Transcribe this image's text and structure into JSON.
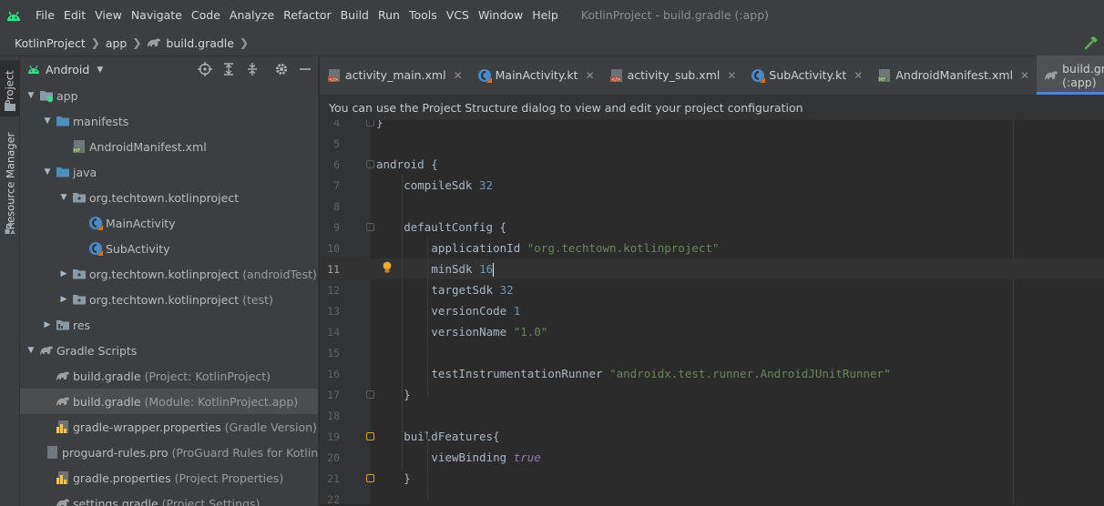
{
  "menubar": {
    "items": [
      "File",
      "Edit",
      "View",
      "Navigate",
      "Code",
      "Analyze",
      "Refactor",
      "Build",
      "Run",
      "Tools",
      "VCS",
      "Window",
      "Help"
    ],
    "window_title": "KotlinProject - build.gradle (:app)"
  },
  "breadcrumb": [
    "KotlinProject",
    "app",
    "build.gradle"
  ],
  "stripe": {
    "project_tab": "Project",
    "resource_tab": "Resource Manager"
  },
  "project_panel": {
    "view_label": "Android",
    "tree": [
      {
        "label": "app",
        "depth": 0,
        "expanded": true,
        "icon": "module-folder-icon",
        "has_arrow": true
      },
      {
        "label": "manifests",
        "depth": 1,
        "expanded": true,
        "icon": "folder-icon",
        "has_arrow": true
      },
      {
        "label": "AndroidManifest.xml",
        "depth": 2,
        "icon": "manifest-file-icon",
        "has_arrow": false
      },
      {
        "label": "java",
        "depth": 1,
        "expanded": true,
        "icon": "folder-icon",
        "has_arrow": true
      },
      {
        "label": "org.techtown.kotlinproject",
        "depth": 2,
        "expanded": true,
        "icon": "package-icon",
        "has_arrow": true
      },
      {
        "label": "MainActivity",
        "depth": 3,
        "icon": "kotlin-class-icon",
        "has_arrow": false
      },
      {
        "label": "SubActivity",
        "depth": 3,
        "icon": "kotlin-class-icon",
        "has_arrow": false
      },
      {
        "label": "org.techtown.kotlinproject",
        "suffix": "(androidTest)",
        "depth": 2,
        "expanded": false,
        "icon": "package-icon",
        "has_arrow": true
      },
      {
        "label": "org.techtown.kotlinproject",
        "suffix": "(test)",
        "depth": 2,
        "expanded": false,
        "icon": "package-icon",
        "has_arrow": true
      },
      {
        "label": "res",
        "depth": 1,
        "expanded": false,
        "icon": "res-folder-icon",
        "has_arrow": true
      },
      {
        "label": "Gradle Scripts",
        "depth": 0,
        "expanded": true,
        "icon": "gradle-icon",
        "has_arrow": true
      },
      {
        "label": "build.gradle",
        "suffix": "(Project: KotlinProject)",
        "depth": 1,
        "icon": "gradle-icon",
        "has_arrow": false
      },
      {
        "label": "build.gradle",
        "suffix": "(Module: KotlinProject.app)",
        "depth": 1,
        "icon": "gradle-icon",
        "has_arrow": false,
        "selected": true
      },
      {
        "label": "gradle-wrapper.properties",
        "suffix": "(Gradle Version)",
        "depth": 1,
        "icon": "properties-icon",
        "has_arrow": false
      },
      {
        "label": "proguard-rules.pro",
        "suffix": "(ProGuard Rules for KotlinProje",
        "depth": 1,
        "icon": "proguard-file-icon",
        "has_arrow": false
      },
      {
        "label": "gradle.properties",
        "suffix": "(Project Properties)",
        "depth": 1,
        "icon": "properties-icon",
        "has_arrow": false
      },
      {
        "label": "settings.gradle",
        "suffix": "(Project Settings)",
        "depth": 1,
        "icon": "gradle-icon",
        "has_arrow": false
      }
    ]
  },
  "tabs": [
    {
      "label": "activity_main.xml",
      "icon": "layout-xml-icon",
      "active": false
    },
    {
      "label": "MainActivity.kt",
      "icon": "kotlin-class-icon",
      "active": false
    },
    {
      "label": "activity_sub.xml",
      "icon": "layout-xml-icon",
      "active": false
    },
    {
      "label": "SubActivity.kt",
      "icon": "kotlin-class-icon",
      "active": false
    },
    {
      "label": "AndroidManifest.xml",
      "icon": "manifest-file-icon",
      "active": false
    },
    {
      "label": "build.gradle (:app)",
      "icon": "gradle-icon",
      "active": true
    }
  ],
  "banner": "You can use the Project Structure dialog to view and edit your project configuration",
  "code": {
    "current_line": 11,
    "lines": [
      {
        "num": "4",
        "indent": 0,
        "tokens": [
          [
            "p",
            "}"
          ]
        ],
        "fold": "end"
      },
      {
        "num": "5",
        "indent": 0,
        "tokens": []
      },
      {
        "num": "6",
        "indent": 0,
        "tokens": [
          [
            "p",
            "android {"
          ]
        ],
        "fold": "start"
      },
      {
        "num": "7",
        "indent": 1,
        "tokens": [
          [
            "p",
            "compileSdk "
          ],
          [
            "n",
            "32"
          ]
        ]
      },
      {
        "num": "8",
        "indent": 0,
        "tokens": []
      },
      {
        "num": "9",
        "indent": 1,
        "tokens": [
          [
            "p",
            "defaultConfig {"
          ]
        ],
        "fold": "start"
      },
      {
        "num": "10",
        "indent": 2,
        "tokens": [
          [
            "p",
            "applicationId "
          ],
          [
            "s",
            "\"org.techtown.kotlinproject\""
          ]
        ]
      },
      {
        "num": "11",
        "indent": 2,
        "tokens": [
          [
            "p",
            "minSdk "
          ],
          [
            "n",
            "16"
          ]
        ],
        "bulb": true,
        "cursor": true
      },
      {
        "num": "12",
        "indent": 2,
        "tokens": [
          [
            "p",
            "targetSdk "
          ],
          [
            "n",
            "32"
          ]
        ]
      },
      {
        "num": "13",
        "indent": 2,
        "tokens": [
          [
            "p",
            "versionCode "
          ],
          [
            "n",
            "1"
          ]
        ]
      },
      {
        "num": "14",
        "indent": 2,
        "tokens": [
          [
            "p",
            "versionName "
          ],
          [
            "s",
            "\"1.0\""
          ]
        ]
      },
      {
        "num": "15",
        "indent": 0,
        "tokens": []
      },
      {
        "num": "16",
        "indent": 2,
        "tokens": [
          [
            "p",
            "testInstrumentationRunner "
          ],
          [
            "s",
            "\"androidx.test.runner.AndroidJUnitRunner\""
          ]
        ]
      },
      {
        "num": "17",
        "indent": 1,
        "tokens": [
          [
            "p",
            "}"
          ]
        ],
        "fold": "end"
      },
      {
        "num": "18",
        "indent": 0,
        "tokens": []
      },
      {
        "num": "19",
        "indent": 1,
        "tokens": [
          [
            "p",
            "buildFeatures{"
          ]
        ],
        "fold": "start-orange"
      },
      {
        "num": "20",
        "indent": 2,
        "tokens": [
          [
            "p",
            "viewBinding "
          ],
          [
            "i",
            "true"
          ]
        ]
      },
      {
        "num": "21",
        "indent": 1,
        "tokens": [
          [
            "p",
            "}"
          ]
        ],
        "fold": "end-orange"
      },
      {
        "num": "22",
        "indent": 0,
        "tokens": []
      }
    ]
  },
  "colors": {
    "background": "#2b2b2b",
    "panel": "#3c3f41",
    "keyword": "#cc7832",
    "string": "#6a8759",
    "number": "#6897bb",
    "literal": "#9876aa",
    "active_tab_underline": "#4a88c7",
    "kotlin_icon": "#4a88c7",
    "android_green": "#3ddc84"
  }
}
